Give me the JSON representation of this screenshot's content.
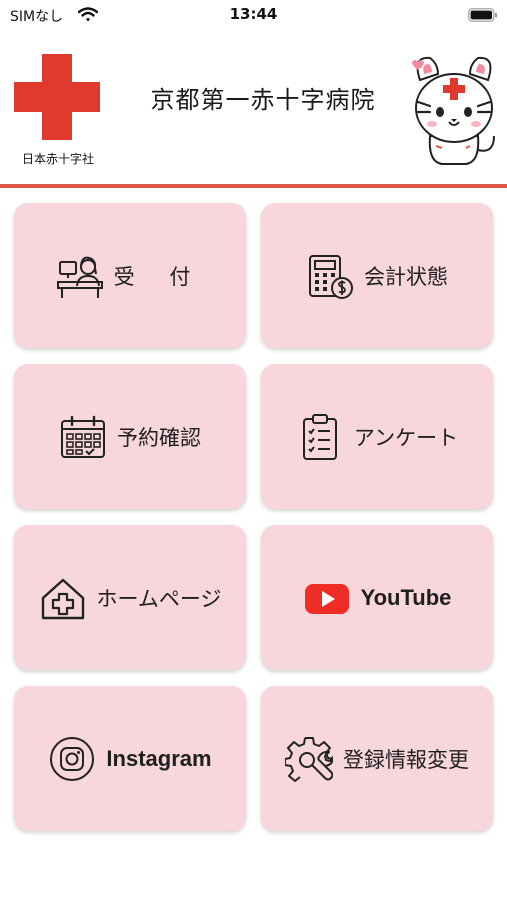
{
  "status_bar": {
    "carrier": "SIMなし",
    "time": "13:44"
  },
  "header": {
    "org_name": "日本赤十字社",
    "hospital_name": "京都第一赤十字病院",
    "brand_color": "#e03a2e",
    "rule_color": "#e05846"
  },
  "menu": {
    "tile_color": "#f7d6dc",
    "items": [
      {
        "label": "受 付",
        "icon": "reception-desk-icon"
      },
      {
        "label": "会計状態",
        "icon": "calculator-money-icon"
      },
      {
        "label": "予約確認",
        "icon": "calendar-check-icon"
      },
      {
        "label": "アンケート",
        "icon": "clipboard-checklist-icon"
      },
      {
        "label": "ホームページ",
        "icon": "hospital-house-icon"
      },
      {
        "label": "YouTube",
        "icon": "youtube-play-icon"
      },
      {
        "label": "Instagram",
        "icon": "instagram-camera-icon"
      },
      {
        "label": "登録情報変更",
        "icon": "settings-wrench-icon"
      }
    ]
  }
}
